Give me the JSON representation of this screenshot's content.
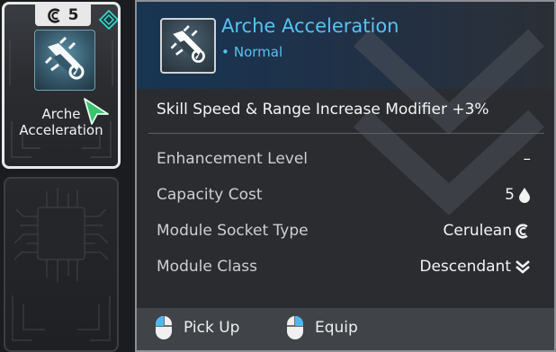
{
  "card": {
    "cost": "5",
    "name_line1": "Arche",
    "name_line2": "Acceleration",
    "icon": "module-icon",
    "socket_icon": "cerulean-socket-icon",
    "gem_icon": "equipped-gem-icon"
  },
  "tooltip": {
    "title": "Arche Acceleration",
    "rarity_dot": "•",
    "rarity": "Normal",
    "effect": "Skill Speed & Range Increase Modifier +3%",
    "stats": [
      {
        "label": "Enhancement Level",
        "value": "–"
      },
      {
        "label": "Capacity Cost",
        "value": "5",
        "icon": "droplet-icon"
      },
      {
        "label": "Module Socket Type",
        "value": "Cerulean",
        "icon": "cerulean-socket-icon"
      },
      {
        "label": "Module Class",
        "value": "Descendant",
        "icon": "descendant-class-icon"
      }
    ],
    "actions": [
      {
        "label": "Pick Up",
        "icon": "mouse-left-click-icon"
      },
      {
        "label": "Equip",
        "icon": "mouse-right-click-icon"
      }
    ]
  },
  "colors": {
    "rarity_blue": "#56c3f2",
    "gem_teal": "#3ad3c8",
    "cursor_green": "#39c46e"
  }
}
